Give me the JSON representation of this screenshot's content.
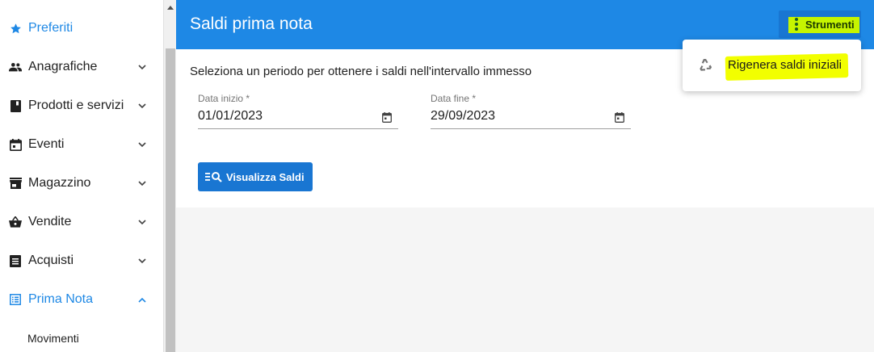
{
  "sidebar": {
    "items": [
      {
        "label": "Preferiti",
        "icon": "star-icon"
      },
      {
        "label": "Anagrafiche",
        "icon": "people-icon"
      },
      {
        "label": "Prodotti e servizi",
        "icon": "book-icon"
      },
      {
        "label": "Eventi",
        "icon": "calendar-icon"
      },
      {
        "label": "Magazzino",
        "icon": "store-icon"
      },
      {
        "label": "Vendite",
        "icon": "basket-icon"
      },
      {
        "label": "Acquisti",
        "icon": "list-icon"
      },
      {
        "label": "Prima Nota",
        "icon": "ledger-icon"
      }
    ],
    "subitems": [
      {
        "label": "Movimenti"
      }
    ]
  },
  "header": {
    "title": "Saldi prima nota",
    "tools_label": "Strumenti"
  },
  "content": {
    "instruction": "Seleziona un periodo per ottenere i saldi nell'intervallo immesso",
    "start_date": {
      "label": "Data inizio *",
      "value": "01/01/2023"
    },
    "end_date": {
      "label": "Data fine *",
      "value": "29/09/2023"
    },
    "show_button": "Visualizza Saldi"
  },
  "menu": {
    "items": [
      {
        "label": "Rigenera saldi iniziali",
        "icon": "recycle-icon"
      }
    ]
  },
  "colors": {
    "primary": "#1e88e5",
    "primary_dark": "#1976d2",
    "highlight_green": "#c6f500",
    "highlight_yellow": "#f2ff00"
  }
}
